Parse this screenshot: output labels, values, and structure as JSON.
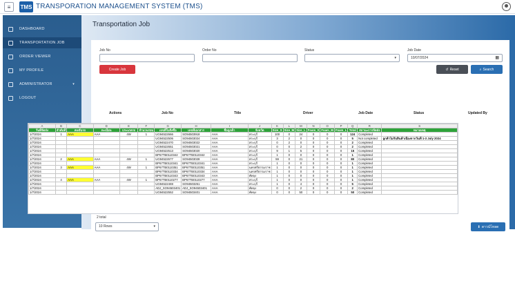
{
  "app": {
    "logo": "TMS",
    "title": "TRANSPORATION MANAGEMENT SYSTEM (TMS)"
  },
  "sidebar": {
    "items": [
      {
        "label": "DASHBOARD",
        "icon": "dashboard-icon"
      },
      {
        "label": "TRANSPORTATION JOB",
        "icon": "truck-icon"
      },
      {
        "label": "ORDER VIEWER",
        "icon": "list-icon"
      },
      {
        "label": "MY PROFILE",
        "icon": "user-icon"
      },
      {
        "label": "ADMINISTRATOR",
        "icon": "tools-icon"
      },
      {
        "label": "LOGOUT",
        "icon": "logout-icon"
      }
    ]
  },
  "page": {
    "title": "Transportation Job"
  },
  "filters": {
    "job_no_label": "Job No",
    "order_no_label": "Order No",
    "status_label": "Status",
    "job_date_label": "Job Date",
    "job_date_value": "10/07/2024"
  },
  "buttons": {
    "create": "Create Job",
    "reset": "Reset",
    "search": "Search",
    "export": "ดาวน์โหลด"
  },
  "table": {
    "headers": [
      "Actions",
      "Job No",
      "Title",
      "Driver",
      "Job Date",
      "Status",
      "Updated By"
    ]
  },
  "sheet": {
    "col_letters": [
      "A",
      "B",
      "C",
      "D",
      "E",
      "F",
      "G",
      "H",
      "I",
      "J",
      "K",
      "L",
      "M",
      "N",
      "O",
      "P",
      "Q",
      "R",
      "S"
    ],
    "header_row": [
      "วันที่จัดส่ง",
      "ลำดับที่",
      "คนขับรถ",
      "ทะเบียน",
      "ประเภทรถ",
      "จำนวนรอบ",
      "เลขที่ใบสั่งซื้อ",
      "เลขที่เอกสาร",
      "ชื่อลูกค้า",
      "จังหวัด",
      "Size_S",
      "Size_M",
      "Size_L",
      "Foam_S",
      "Foam_M",
      "Foam_L",
      "Total",
      "สถานะการจัดส่ง",
      "หมายเหตุ"
    ],
    "rows": [
      [
        "1/7/2024",
        "1",
        "AAA",
        "AAA",
        "4W",
        "1",
        "UG94522666",
        "SO94503918",
        "AAA",
        "สระบุรี",
        "100",
        "0",
        "24",
        "0",
        "0",
        "0",
        "124",
        "Completed",
        ""
      ],
      [
        "1/7/2024",
        "",
        "",
        "",
        "",
        "",
        "UG94522506",
        "SO94503024",
        "AAA",
        "สระบุรี",
        "3",
        "2",
        "0",
        "0",
        "0",
        "0",
        "5",
        "Not completed",
        "ลูกค้าไม่รับสินค้าเนื่องจากวันที่ 1-3 July 2024"
      ],
      [
        "1/7/2024",
        "",
        "",
        "",
        "",
        "",
        "UG94522470",
        "SO94503022",
        "AAA",
        "สระบุรี",
        "0",
        "2",
        "0",
        "0",
        "0",
        "0",
        "2",
        "Completed",
        ""
      ],
      [
        "1/7/2024",
        "",
        "",
        "",
        "",
        "",
        "UG94522651",
        "SO94503021",
        "AAA",
        "สระบุรี",
        "0",
        "0",
        "2",
        "0",
        "0",
        "0",
        "2",
        "Completed",
        ""
      ],
      [
        "1/7/2024",
        "",
        "",
        "",
        "",
        "",
        "UG94522513",
        "SO94503020",
        "AAA",
        "สระบุรี",
        "9",
        "1",
        "5",
        "0",
        "0",
        "0",
        "15",
        "Completed",
        ""
      ],
      [
        "1/7/2024",
        "",
        "",
        "",
        "",
        "",
        "BP67TB0110342",
        "BP67TB0110342",
        "AAA",
        "สระบุรี",
        "1",
        "0",
        "0",
        "0",
        "0",
        "0",
        "1",
        "Completed",
        ""
      ],
      [
        "1/7/2024",
        "2",
        "AAA",
        "AAA",
        "4W",
        "1",
        "UG94522677",
        "SO94503028",
        "AAA",
        "สระบุรี",
        "59",
        "0",
        "21",
        "0",
        "0",
        "0",
        "80",
        "Completed",
        ""
      ],
      [
        "1/7/2024",
        "",
        "",
        "",
        "",
        "",
        "BP67TB0110341",
        "BP67TB0110341",
        "AAA",
        "สระบุรี",
        "1",
        "0",
        "0",
        "0",
        "0",
        "0",
        "1",
        "Completed",
        ""
      ],
      [
        "1/7/2024",
        "3",
        "AAA",
        "AAA",
        "4W",
        "1",
        "BP67TB0110351",
        "BP67TB0110351",
        "AAA",
        "นครศรีธรรมราช",
        "1",
        "0",
        "0",
        "0",
        "0",
        "0",
        "1",
        "Completed",
        ""
      ],
      [
        "1/7/2024",
        "",
        "",
        "",
        "",
        "",
        "BP67TB0110334",
        "BP67TB0110334",
        "AAA",
        "นครศรีธรรมราช",
        "1",
        "0",
        "0",
        "0",
        "0",
        "0",
        "1",
        "Completed",
        ""
      ],
      [
        "1/7/2024",
        "",
        "",
        "",
        "",
        "",
        "BP67TB0110343",
        "BP67TB0110343",
        "AAA",
        "พัทลุง",
        "1",
        "0",
        "0",
        "0",
        "0",
        "0",
        "1",
        "Completed",
        ""
      ],
      [
        "1/7/2024",
        "4",
        "AAA",
        "AAA",
        "4W",
        "1",
        "BP67TB0110277",
        "BP67TB0110277",
        "AAA",
        "สระบุรี",
        "1",
        "0",
        "0",
        "0",
        "0",
        "0",
        "1",
        "Completed",
        ""
      ],
      [
        "1/7/2024",
        "",
        "",
        "",
        "",
        "",
        "UG94522469",
        "SO94503251",
        "AAA",
        "สระบุรี",
        "1",
        "0",
        "4",
        "0",
        "0",
        "0",
        "5",
        "Completed",
        ""
      ],
      [
        "1/7/2024",
        "",
        "",
        "",
        "",
        "",
        "ADJ_SO94503401",
        "ADJ_SO94503401",
        "AAA",
        "พัทลุง",
        "0",
        "0",
        "2",
        "0",
        "0",
        "0",
        "2",
        "Completed",
        ""
      ],
      [
        "1/7/2024",
        "",
        "",
        "",
        "",
        "",
        "UG94522552",
        "SO94503401",
        "AAA",
        "พัทลุง",
        "0",
        "0",
        "50",
        "0",
        "0",
        "0",
        "50",
        "Completed",
        ""
      ]
    ]
  },
  "pagination": {
    "total": "2 total",
    "rows_option": "10 Rows"
  }
}
